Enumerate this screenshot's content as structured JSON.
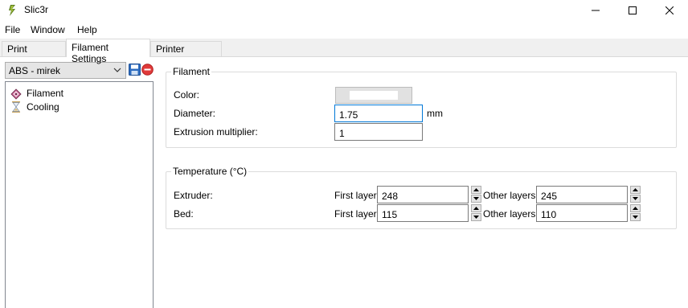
{
  "window": {
    "title": "Slic3r"
  },
  "menu": {
    "file": "File",
    "window": "Window",
    "help": "Help"
  },
  "tabs": {
    "print": "Print Settings",
    "filament": "Filament Settings",
    "printer": "Printer Settings"
  },
  "preset": {
    "selected": "ABS - mirek"
  },
  "tree": {
    "filament": "Filament",
    "cooling": "Cooling"
  },
  "filament_group": {
    "title": "Filament",
    "color_label": "Color:",
    "color_value": "#ffffff",
    "diameter_label": "Diameter:",
    "diameter_value": "1.75",
    "diameter_unit": "mm",
    "extrusion_label": "Extrusion multiplier:",
    "extrusion_value": "1"
  },
  "temperature_group": {
    "title": "Temperature (°C)",
    "extruder_label": "Extruder:",
    "bed_label": "Bed:",
    "first_layer_label": "First layer:",
    "other_layers_label": "Other layers:",
    "extruder_first": "248",
    "extruder_other": "245",
    "bed_first": "115",
    "bed_other": "110"
  },
  "colors": {
    "focus_border": "#0078d7",
    "delete_red": "#e03a3a",
    "save_blue": "#2d6cc0"
  }
}
